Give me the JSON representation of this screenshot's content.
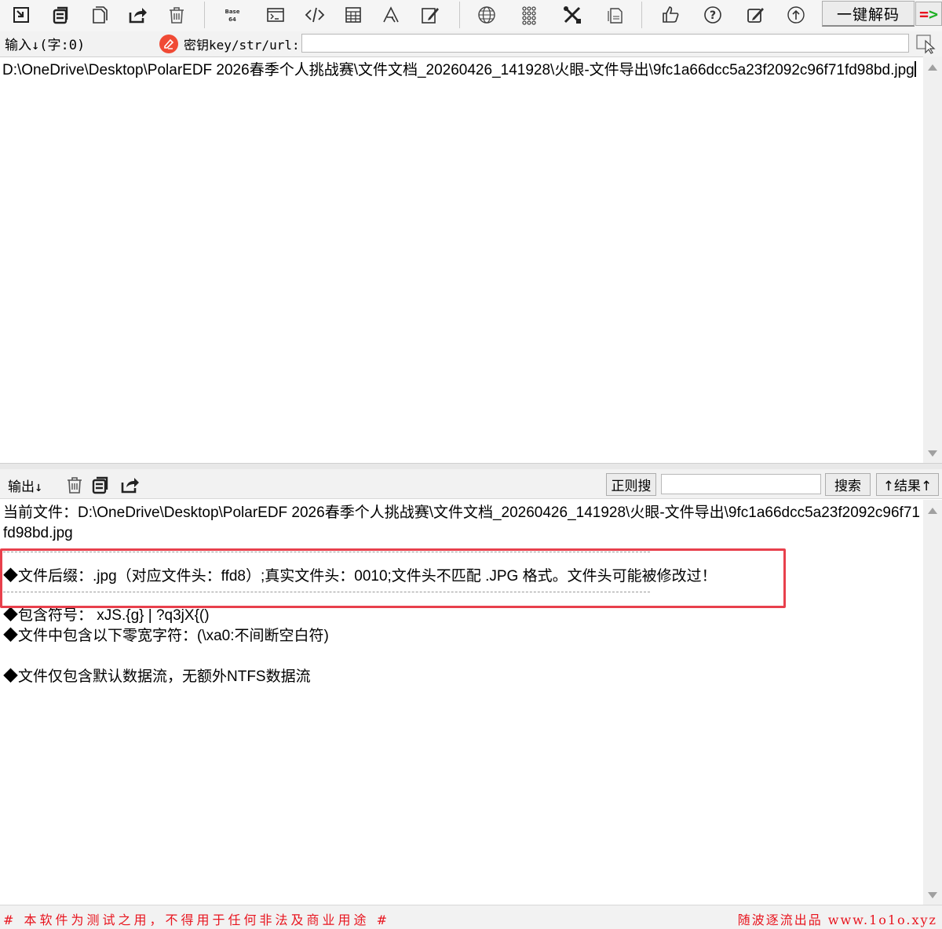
{
  "toolbar": {
    "decode_label": "一键解码",
    "arrow_eq": "=",
    "arrow_gt": ">",
    "icons": [
      "import-icon",
      "copy-icon",
      "paste-icon",
      "export-icon",
      "trash-icon",
      "base64-icon",
      "terminal-icon",
      "code-icon",
      "calculator-icon",
      "font-icon",
      "edit-icon",
      "globe-icon",
      "grid-icon",
      "tools-icon",
      "file-icon",
      "thumbs-up-icon",
      "help-icon",
      "edit-note-icon",
      "upload-icon"
    ]
  },
  "input": {
    "label": "输入↓(字:0)",
    "key_label": "密钥key/str/url:",
    "key_value": "",
    "text": "D:\\OneDrive\\Desktop\\PolarEDF 2026春季个人挑战赛\\文件文档_20260426_141928\\火眼-文件导出\\9fc1a66dcc5a23f2092c96f71fd98bd.jpg"
  },
  "output": {
    "label": "输出↓",
    "regex_label": "正则搜",
    "search_value": "",
    "search_label": "搜索",
    "result_label": "↑结果↑",
    "current_file": "当前文件：D:\\OneDrive\\Desktop\\PolarEDF 2026春季个人挑战赛\\文件文档_20260426_141928\\火眼-文件导出\\9fc1a66dcc5a23f2092c96f71fd98bd.jpg",
    "line_suffix": "◆文件后缀：.jpg（对应文件头：ffd8）;真实文件头：0010;文件头不匹配 .JPG 格式。文件头可能被修改过！",
    "line_symbols": "◆包含符号：  xJS.{g} | ?q3jX{()",
    "line_zero_width": "◆文件中包含以下零宽字符：(\\xa0:不间断空白符)",
    "line_ntfs": "◆文件仅包含默认数据流，无额外NTFS数据流"
  },
  "footer": {
    "left": "# 本软件为测试之用，不得用于任何非法及商业用途 #",
    "right": "随波逐流出品 www.1o1o.xyz"
  },
  "colors": {
    "accent_red": "#e8141e",
    "highlight_box": "#e8404c",
    "arrow_green": "#1fb025"
  }
}
